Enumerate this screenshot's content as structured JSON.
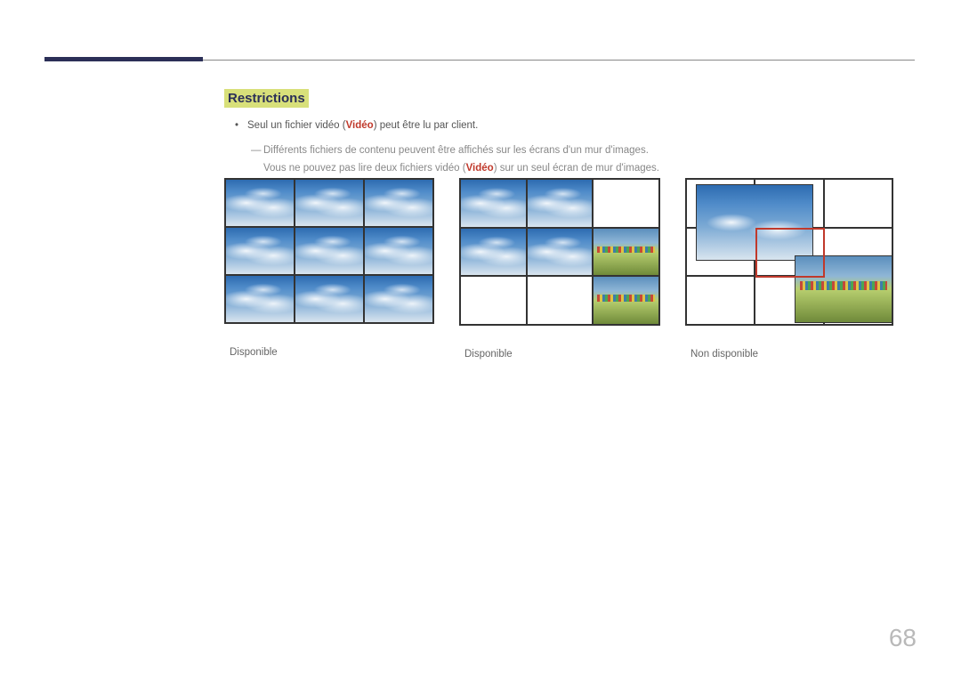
{
  "heading": "Restrictions",
  "bullet": {
    "prefix": "Seul un fichier vidéo (",
    "keyword": "Vidéo",
    "suffix": ") peut être lu par client."
  },
  "sub": {
    "line1": "Différents fichiers de contenu peuvent être affichés sur les écrans d'un mur d'images.",
    "line2_prefix": "Vous ne pouvez pas lire deux fichiers vidéo (",
    "line2_keyword": "Vidéo",
    "line2_suffix": ") sur un seul écran de mur d'images."
  },
  "captions": {
    "a": "Disponible",
    "b": "Disponible",
    "c": "Non disponible"
  },
  "page_number": "68"
}
